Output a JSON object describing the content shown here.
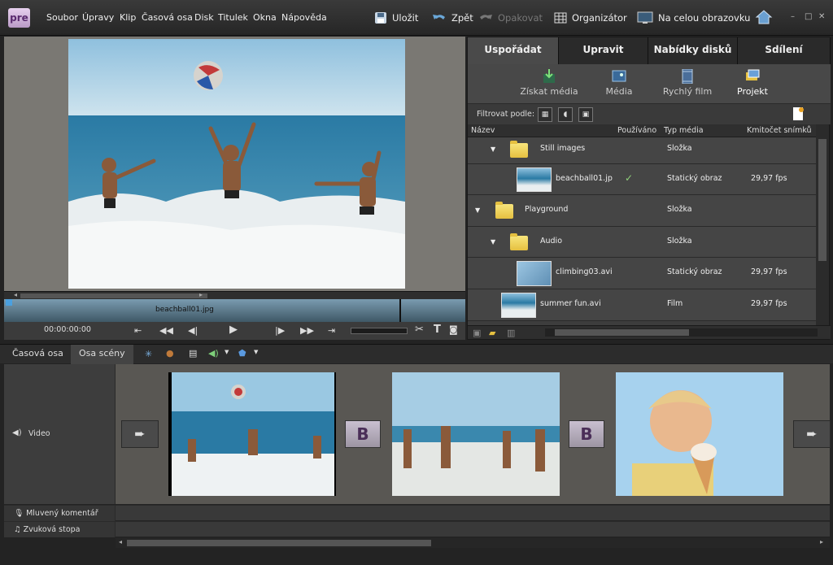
{
  "app": {
    "logo": "pre"
  },
  "menu": [
    "Soubor",
    "Úpravy",
    "Klip",
    "Časová osa",
    "Disk",
    "Titulek",
    "Okna",
    "Nápověda"
  ],
  "toolbar": {
    "save": "Uložit",
    "undo": "Zpět",
    "redo": "Opakovat",
    "organizer": "Organizátor",
    "fullscreen": "Na celou obrazovku"
  },
  "monitor": {
    "clip_name": "beachball01.jpg",
    "timecode": "00:00:00:00"
  },
  "tabs": [
    "Uspořádat",
    "Upravit",
    "Nabídky disků",
    "Sdílení"
  ],
  "subtabs": [
    "Získat média",
    "Média",
    "Rychlý film",
    "Projekt"
  ],
  "filter_label": "Filtrovat podle:",
  "columns": {
    "name": "Název",
    "used": "Používáno",
    "type": "Typ média",
    "fps": "Kmitočet snímků"
  },
  "rows": [
    {
      "name": "Still images",
      "type": "Složka",
      "used": "",
      "fps": ""
    },
    {
      "name": "beachball01.jp",
      "type": "Statický obraz",
      "used": "✓",
      "fps": "29,97 fps"
    },
    {
      "name": "Playground",
      "type": "Složka",
      "used": "",
      "fps": ""
    },
    {
      "name": "Audio",
      "type": "Složka",
      "used": "",
      "fps": ""
    },
    {
      "name": "climbing03.avi",
      "type": "Statický obraz",
      "used": "",
      "fps": "29,97 fps"
    },
    {
      "name": "summer fun.avi",
      "type": "Film",
      "used": "",
      "fps": "29,97 fps"
    }
  ],
  "bottom_tabs": [
    "Časová osa",
    "Osa scény"
  ],
  "tracks": {
    "video": "Video",
    "narration": "Mluvený komentář",
    "soundtrack": "Zvuková stopa"
  },
  "transition_label": "B"
}
